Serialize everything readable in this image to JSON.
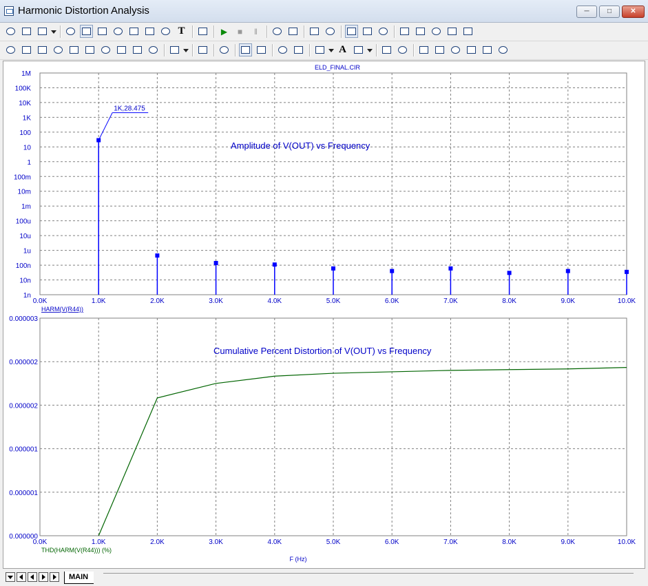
{
  "window": {
    "title": "Harmonic Distortion Analysis",
    "controls": [
      "minimize-icon",
      "maximize-icon",
      "close-icon"
    ]
  },
  "toolbar1": {
    "text_tool_label": "T",
    "icons": [
      "select-arrow-icon",
      "pan-hand-icon",
      "copy-icon",
      "image-icon",
      "scope-icon",
      "graph-icon",
      "zoom-box-icon",
      "marker-icon",
      "fit-icon",
      "function-icon",
      "text-icon",
      "properties-icon",
      "run-icon",
      "stop-icon",
      "pause-icon",
      "cursor-icon",
      "peak-icon",
      "frame-icon",
      "grid-icon",
      "plot-layout-icon",
      "split-icon",
      "window-icon",
      "zoom-in-icon",
      "zoom-out-icon",
      "zoom-fit-icon",
      "zoom-all-icon",
      "settings-icon"
    ]
  },
  "toolbar2": {
    "font_tool_label": "A",
    "icons": [
      "align-icon",
      "cursor-left-icon",
      "cursor-right-icon",
      "peak-icon",
      "valley-icon",
      "slope-icon",
      "crossing-icon",
      "data-point-icon",
      "rise-icon",
      "fall-icon",
      "paste-icon",
      "list-icon",
      "clipboard-icon",
      "tile-icon",
      "fit-icon",
      "zoom-in-icon",
      "zoom-out-icon",
      "dots-icon",
      "font-icon",
      "spell-icon",
      "front-icon",
      "back-icon",
      "align-left-icon",
      "align-center-icon",
      "align-right-icon",
      "align-top-icon",
      "align-middle-icon",
      "align-bottom-icon"
    ]
  },
  "statusbar": {
    "tab_label": "MAIN"
  },
  "colors": {
    "axis_text": "#0000c8",
    "amplitude": "#0000ff",
    "thd": "#006400",
    "grid": "#808080"
  },
  "chart_data": [
    {
      "type": "bar",
      "title": "Amplitude of V(OUT) vs Frequency",
      "file_label": "ELD_FINAL.CIR",
      "xlabel": "HARM(V(R44))",
      "x_ticks": [
        "0.0K",
        "1.0K",
        "2.0K",
        "3.0K",
        "4.0K",
        "5.0K",
        "6.0K",
        "7.0K",
        "8.0K",
        "9.0K",
        "10.0K"
      ],
      "y_ticks": [
        "1M",
        "100K",
        "10K",
        "1K",
        "100",
        "10",
        "1",
        "100m",
        "10m",
        "1m",
        "100u",
        "10u",
        "1u",
        "100n",
        "10n",
        "1n"
      ],
      "y_scale": "log",
      "xlim": [
        0,
        10000
      ],
      "ylim": [
        1e-09,
        1000000.0
      ],
      "grid": true,
      "x": [
        1000,
        2000,
        3000,
        4000,
        5000,
        6000,
        7000,
        8000,
        9000,
        10000
      ],
      "values": [
        28.475,
        4.5e-07,
        1.4e-07,
        1.1e-07,
        6e-08,
        4e-08,
        6e-08,
        3e-08,
        4e-08,
        3.5e-08
      ],
      "annotation": "1K,28.475"
    },
    {
      "type": "line",
      "title": "Cumulative Percent Distortion of V(OUT) vs Frequency",
      "xlabel": "THD(HARM(V(R44))) (%)",
      "axis_title": "F (Hz)",
      "x_ticks": [
        "0.0K",
        "1.0K",
        "2.0K",
        "3.0K",
        "4.0K",
        "5.0K",
        "6.0K",
        "7.0K",
        "8.0K",
        "9.0K",
        "10.0K"
      ],
      "y_ticks": [
        "0.000003",
        "0.000002",
        "0.000002",
        "0.000001",
        "0.000001",
        "0.000000"
      ],
      "xlim": [
        0,
        10000
      ],
      "ylim": [
        0,
        3e-06
      ],
      "grid": true,
      "x": [
        1000,
        2000,
        3000,
        4000,
        5000,
        6000,
        7000,
        8000,
        9000,
        10000
      ],
      "values": [
        0,
        1.9e-06,
        2.1e-06,
        2.2e-06,
        2.24e-06,
        2.26e-06,
        2.28e-06,
        2.29e-06,
        2.3e-06,
        2.32e-06
      ]
    }
  ]
}
